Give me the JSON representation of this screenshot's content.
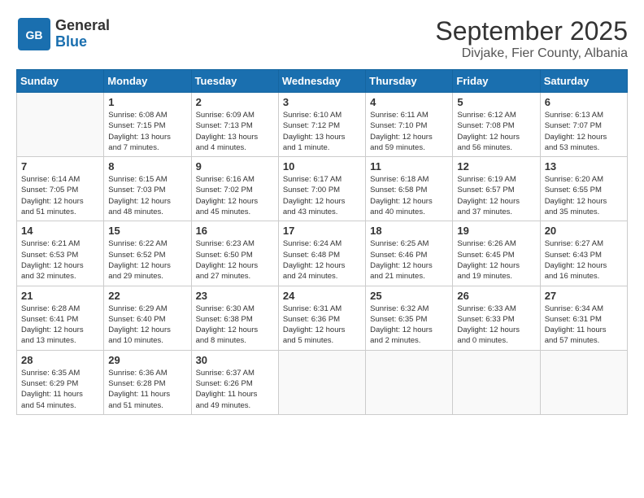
{
  "header": {
    "logo_line1": "General",
    "logo_line2": "Blue",
    "month": "September 2025",
    "location": "Divjake, Fier County, Albania"
  },
  "days_of_week": [
    "Sunday",
    "Monday",
    "Tuesday",
    "Wednesday",
    "Thursday",
    "Friday",
    "Saturday"
  ],
  "weeks": [
    [
      {
        "day": "",
        "info": ""
      },
      {
        "day": "1",
        "info": "Sunrise: 6:08 AM\nSunset: 7:15 PM\nDaylight: 13 hours\nand 7 minutes."
      },
      {
        "day": "2",
        "info": "Sunrise: 6:09 AM\nSunset: 7:13 PM\nDaylight: 13 hours\nand 4 minutes."
      },
      {
        "day": "3",
        "info": "Sunrise: 6:10 AM\nSunset: 7:12 PM\nDaylight: 13 hours\nand 1 minute."
      },
      {
        "day": "4",
        "info": "Sunrise: 6:11 AM\nSunset: 7:10 PM\nDaylight: 12 hours\nand 59 minutes."
      },
      {
        "day": "5",
        "info": "Sunrise: 6:12 AM\nSunset: 7:08 PM\nDaylight: 12 hours\nand 56 minutes."
      },
      {
        "day": "6",
        "info": "Sunrise: 6:13 AM\nSunset: 7:07 PM\nDaylight: 12 hours\nand 53 minutes."
      }
    ],
    [
      {
        "day": "7",
        "info": "Sunrise: 6:14 AM\nSunset: 7:05 PM\nDaylight: 12 hours\nand 51 minutes."
      },
      {
        "day": "8",
        "info": "Sunrise: 6:15 AM\nSunset: 7:03 PM\nDaylight: 12 hours\nand 48 minutes."
      },
      {
        "day": "9",
        "info": "Sunrise: 6:16 AM\nSunset: 7:02 PM\nDaylight: 12 hours\nand 45 minutes."
      },
      {
        "day": "10",
        "info": "Sunrise: 6:17 AM\nSunset: 7:00 PM\nDaylight: 12 hours\nand 43 minutes."
      },
      {
        "day": "11",
        "info": "Sunrise: 6:18 AM\nSunset: 6:58 PM\nDaylight: 12 hours\nand 40 minutes."
      },
      {
        "day": "12",
        "info": "Sunrise: 6:19 AM\nSunset: 6:57 PM\nDaylight: 12 hours\nand 37 minutes."
      },
      {
        "day": "13",
        "info": "Sunrise: 6:20 AM\nSunset: 6:55 PM\nDaylight: 12 hours\nand 35 minutes."
      }
    ],
    [
      {
        "day": "14",
        "info": "Sunrise: 6:21 AM\nSunset: 6:53 PM\nDaylight: 12 hours\nand 32 minutes."
      },
      {
        "day": "15",
        "info": "Sunrise: 6:22 AM\nSunset: 6:52 PM\nDaylight: 12 hours\nand 29 minutes."
      },
      {
        "day": "16",
        "info": "Sunrise: 6:23 AM\nSunset: 6:50 PM\nDaylight: 12 hours\nand 27 minutes."
      },
      {
        "day": "17",
        "info": "Sunrise: 6:24 AM\nSunset: 6:48 PM\nDaylight: 12 hours\nand 24 minutes."
      },
      {
        "day": "18",
        "info": "Sunrise: 6:25 AM\nSunset: 6:46 PM\nDaylight: 12 hours\nand 21 minutes."
      },
      {
        "day": "19",
        "info": "Sunrise: 6:26 AM\nSunset: 6:45 PM\nDaylight: 12 hours\nand 19 minutes."
      },
      {
        "day": "20",
        "info": "Sunrise: 6:27 AM\nSunset: 6:43 PM\nDaylight: 12 hours\nand 16 minutes."
      }
    ],
    [
      {
        "day": "21",
        "info": "Sunrise: 6:28 AM\nSunset: 6:41 PM\nDaylight: 12 hours\nand 13 minutes."
      },
      {
        "day": "22",
        "info": "Sunrise: 6:29 AM\nSunset: 6:40 PM\nDaylight: 12 hours\nand 10 minutes."
      },
      {
        "day": "23",
        "info": "Sunrise: 6:30 AM\nSunset: 6:38 PM\nDaylight: 12 hours\nand 8 minutes."
      },
      {
        "day": "24",
        "info": "Sunrise: 6:31 AM\nSunset: 6:36 PM\nDaylight: 12 hours\nand 5 minutes."
      },
      {
        "day": "25",
        "info": "Sunrise: 6:32 AM\nSunset: 6:35 PM\nDaylight: 12 hours\nand 2 minutes."
      },
      {
        "day": "26",
        "info": "Sunrise: 6:33 AM\nSunset: 6:33 PM\nDaylight: 12 hours\nand 0 minutes."
      },
      {
        "day": "27",
        "info": "Sunrise: 6:34 AM\nSunset: 6:31 PM\nDaylight: 11 hours\nand 57 minutes."
      }
    ],
    [
      {
        "day": "28",
        "info": "Sunrise: 6:35 AM\nSunset: 6:29 PM\nDaylight: 11 hours\nand 54 minutes."
      },
      {
        "day": "29",
        "info": "Sunrise: 6:36 AM\nSunset: 6:28 PM\nDaylight: 11 hours\nand 51 minutes."
      },
      {
        "day": "30",
        "info": "Sunrise: 6:37 AM\nSunset: 6:26 PM\nDaylight: 11 hours\nand 49 minutes."
      },
      {
        "day": "",
        "info": ""
      },
      {
        "day": "",
        "info": ""
      },
      {
        "day": "",
        "info": ""
      },
      {
        "day": "",
        "info": ""
      }
    ]
  ]
}
